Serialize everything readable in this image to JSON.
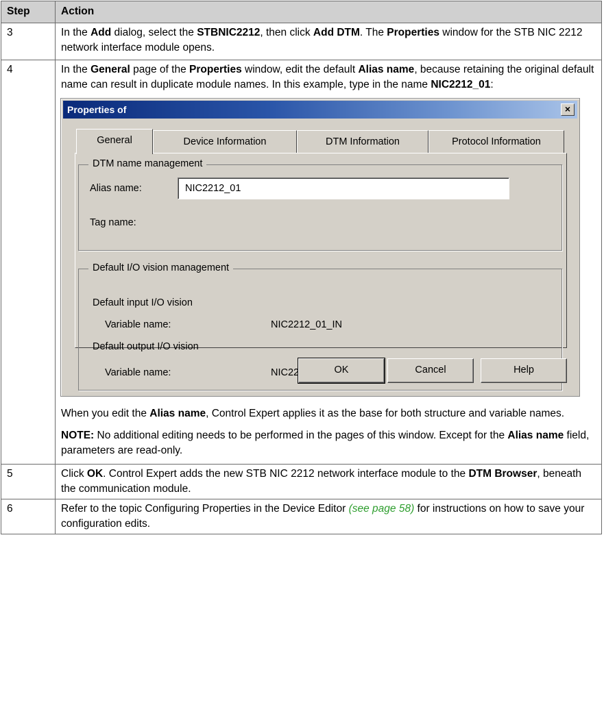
{
  "table": {
    "header": {
      "step": "Step",
      "action": "Action"
    },
    "row3": {
      "step": "3",
      "parts": [
        "In the ",
        "Add",
        " dialog, select the ",
        "STBNIC2212",
        ", then click ",
        "Add DTM",
        ". The ",
        "Properties",
        " window for the STB NIC 2212 network interface module opens."
      ]
    },
    "row4": {
      "step": "4",
      "parts": [
        "In the ",
        "General",
        " page of the ",
        "Properties",
        " window, edit the default ",
        "Alias name",
        ", because retaining the original default name can result in duplicate module names. In this example, type in the name ",
        "NIC2212_01",
        ":"
      ],
      "after": [
        "When you edit the ",
        "Alias name",
        ", Control Expert applies it as the base for both structure and variable names."
      ],
      "note": [
        "NOTE:",
        " No additional editing needs to be performed in the pages of this window. Except for the ",
        "Alias name",
        " field, parameters are read-only."
      ]
    },
    "row5": {
      "step": "5",
      "parts": [
        "Click ",
        "OK",
        ". Control Expert adds the new STB NIC 2212 network interface module to the ",
        "DTM Browser",
        ", beneath the communication module."
      ]
    },
    "row6": {
      "step": "6",
      "text": "Refer to the topic Configuring Properties in the Device Editor ",
      "link": "(see page 58)",
      "text2": " for instructions on how to save your configuration edits."
    }
  },
  "dialog": {
    "title": "Properties of",
    "close_glyph": "×",
    "tabs": [
      "General",
      "Device Information",
      "DTM Information",
      "Protocol Information"
    ],
    "group1_title": "DTM name management",
    "alias_label": "Alias name:",
    "alias_value": "NIC2212_01",
    "tag_label": "Tag name:",
    "group2_title": "Default I/O vision management",
    "input_vision": "Default input I/O vision",
    "var_label": "Variable name:",
    "input_var": "NIC2212_01_IN",
    "output_vision": "Default output I/O vision",
    "output_var": "NIC2212_01_OUT",
    "buttons": {
      "ok": "OK",
      "cancel": "Cancel",
      "help": "Help"
    }
  }
}
